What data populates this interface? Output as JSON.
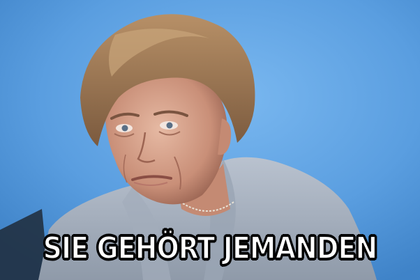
{
  "meme": {
    "caption": "SIE GEHÖRT JEMANDEN",
    "photo_subject": "woman-portrait",
    "background_color": "#5a9ee0",
    "caption_color": "#ffffff",
    "caption_outline_color": "#000000"
  }
}
